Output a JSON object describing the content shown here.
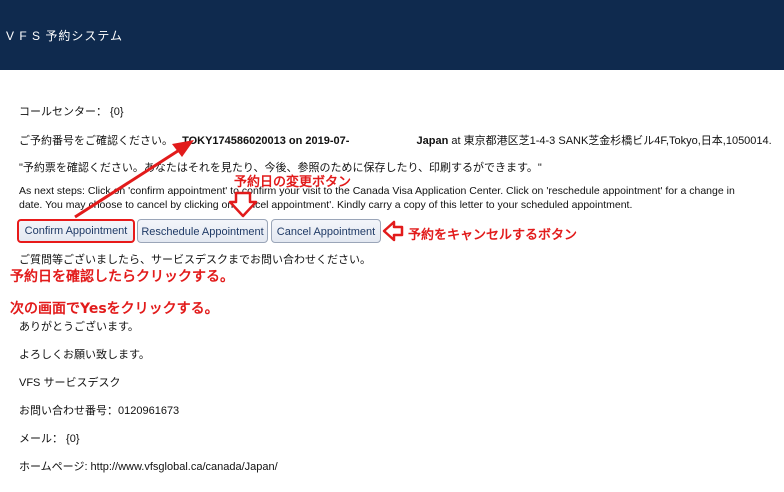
{
  "header": {
    "title": "V F S 予約システム"
  },
  "email": {
    "call_center": "コールセンター： {0}",
    "ref_prefix": "ご予約番号をご確認ください。",
    "ref_number": "TOKY174586020013",
    "ref_mid": "on",
    "ref_date": "2019-07-",
    "ref_location": "Japan",
    "ref_address": "at 東京都港区芝1-4-3 SANK芝金杉橋ビル4F,Tokyo,日本,1050014.",
    "confirm_note": "\"予約票を確認ください。あなたはそれを見たり、今後、参照のために保存したり、印刷するができます。\"",
    "next_steps": "As next steps: Click on 'confirm appointment' to confirm your visit to the Canada Visa Application Center. Click on 'reschedule appointment' for a change in date. You may choose to cancel by clicking on 'cancel appointment'. Kindly carry a copy of this letter to your scheduled appointment.",
    "buttons": {
      "confirm": "Confirm Appointment",
      "reschedule": "Reschedule Appointment",
      "cancel": "Cancel Appointment"
    },
    "questions": "ご質問等ございましたら、サービスデスクまでお問い合わせください。",
    "thanks": "ありがとうございます。",
    "regards": "よろしくお願い致します。",
    "desk": "VFS サービスデスク",
    "inquiry": "お問い合わせ番号：0120961673",
    "mail": "メール： {0}",
    "homepage": "ホームページ: http://www.vfsglobal.ca/canada/Japan/"
  },
  "annotations": {
    "reschedule_note": "予約日の変更ボタン",
    "cancel_note": "予約をキャンセルするボタン",
    "confirm_note": "予約日を確認したらクリックする。",
    "yes_note": "次の画面でYesをクリックする。",
    "color": "#e21b1b"
  }
}
